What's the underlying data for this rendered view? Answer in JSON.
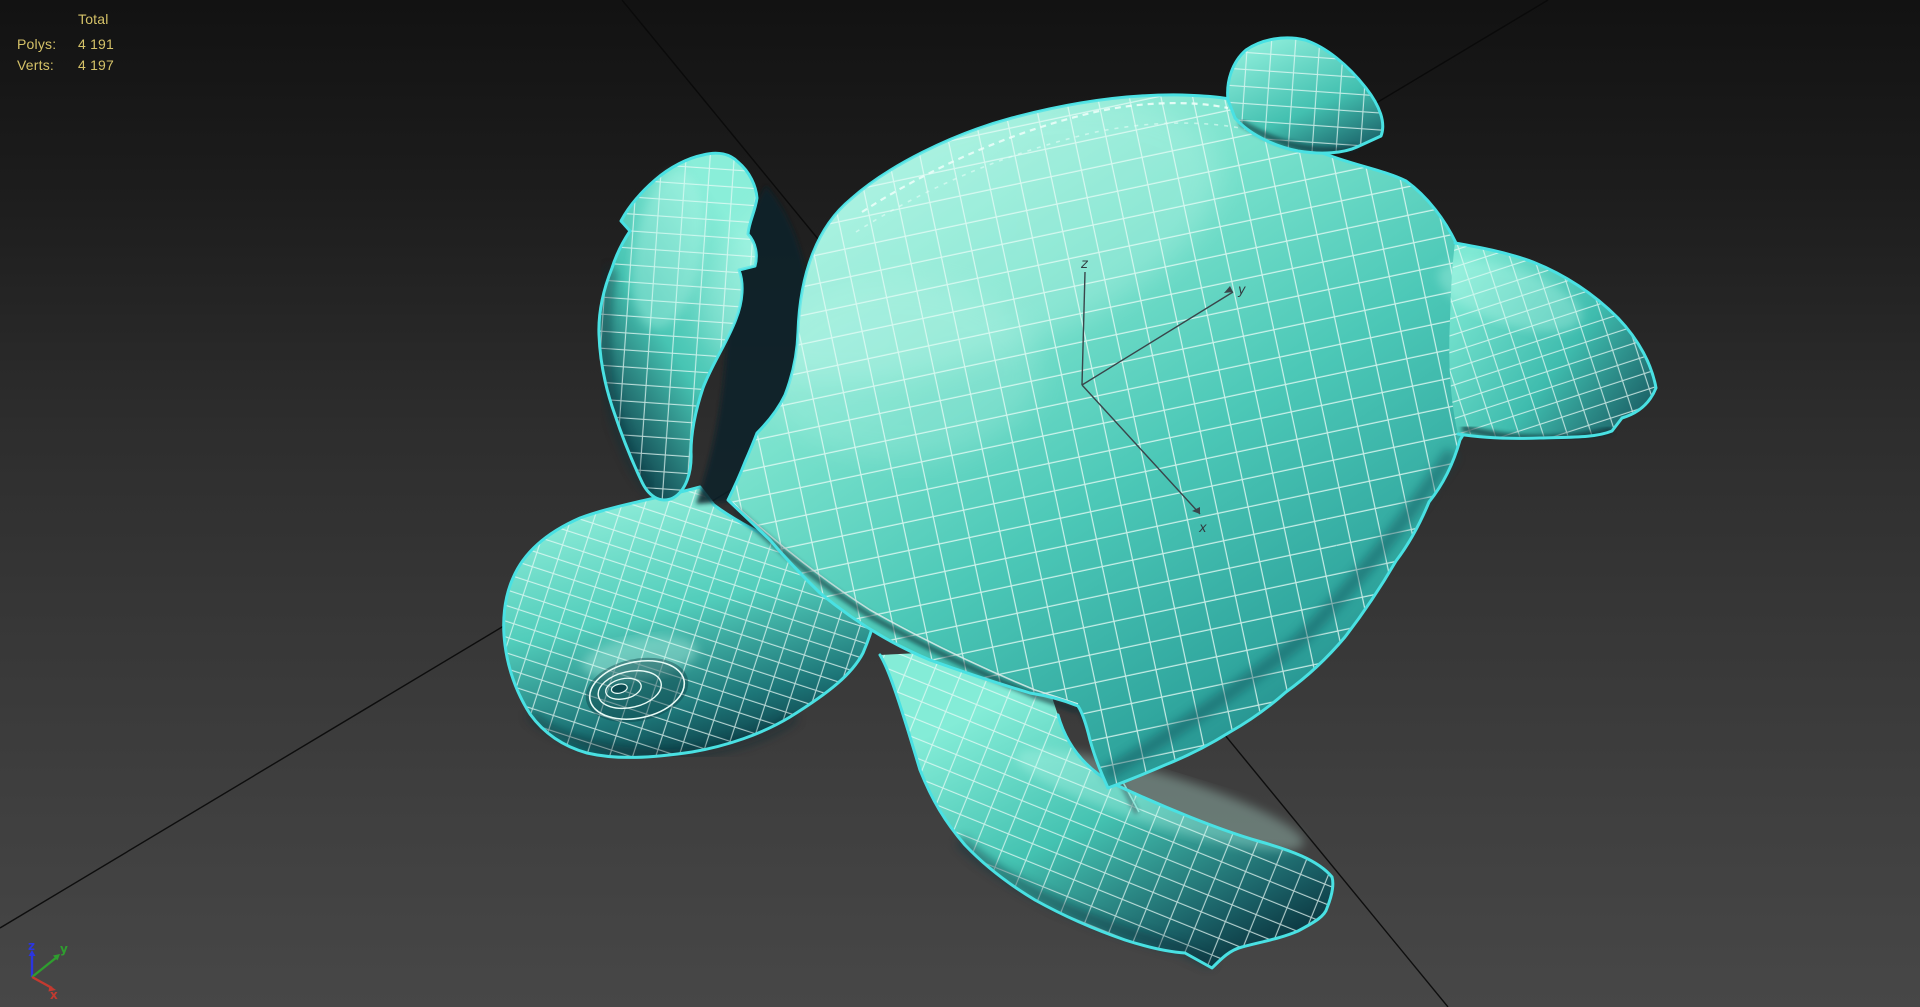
{
  "hud": {
    "stats": {
      "total_label": "Total",
      "polys_label": "Polys:",
      "polys_value": "4 191",
      "verts_label": "Verts:",
      "verts_value": "4 197"
    }
  },
  "tripod": {
    "x_label": "x",
    "y_label": "y",
    "z_label": "z"
  },
  "world_axis": {
    "x_label": "x",
    "y_label": "y",
    "z_label": "z"
  },
  "colors": {
    "stats_text": "#d5c268",
    "selection_outline": "#49e1e3",
    "wireframe": "#e9fbf6",
    "axis_x": "#c23a30",
    "axis_y": "#2f9e2f",
    "axis_z": "#2b35e0"
  }
}
